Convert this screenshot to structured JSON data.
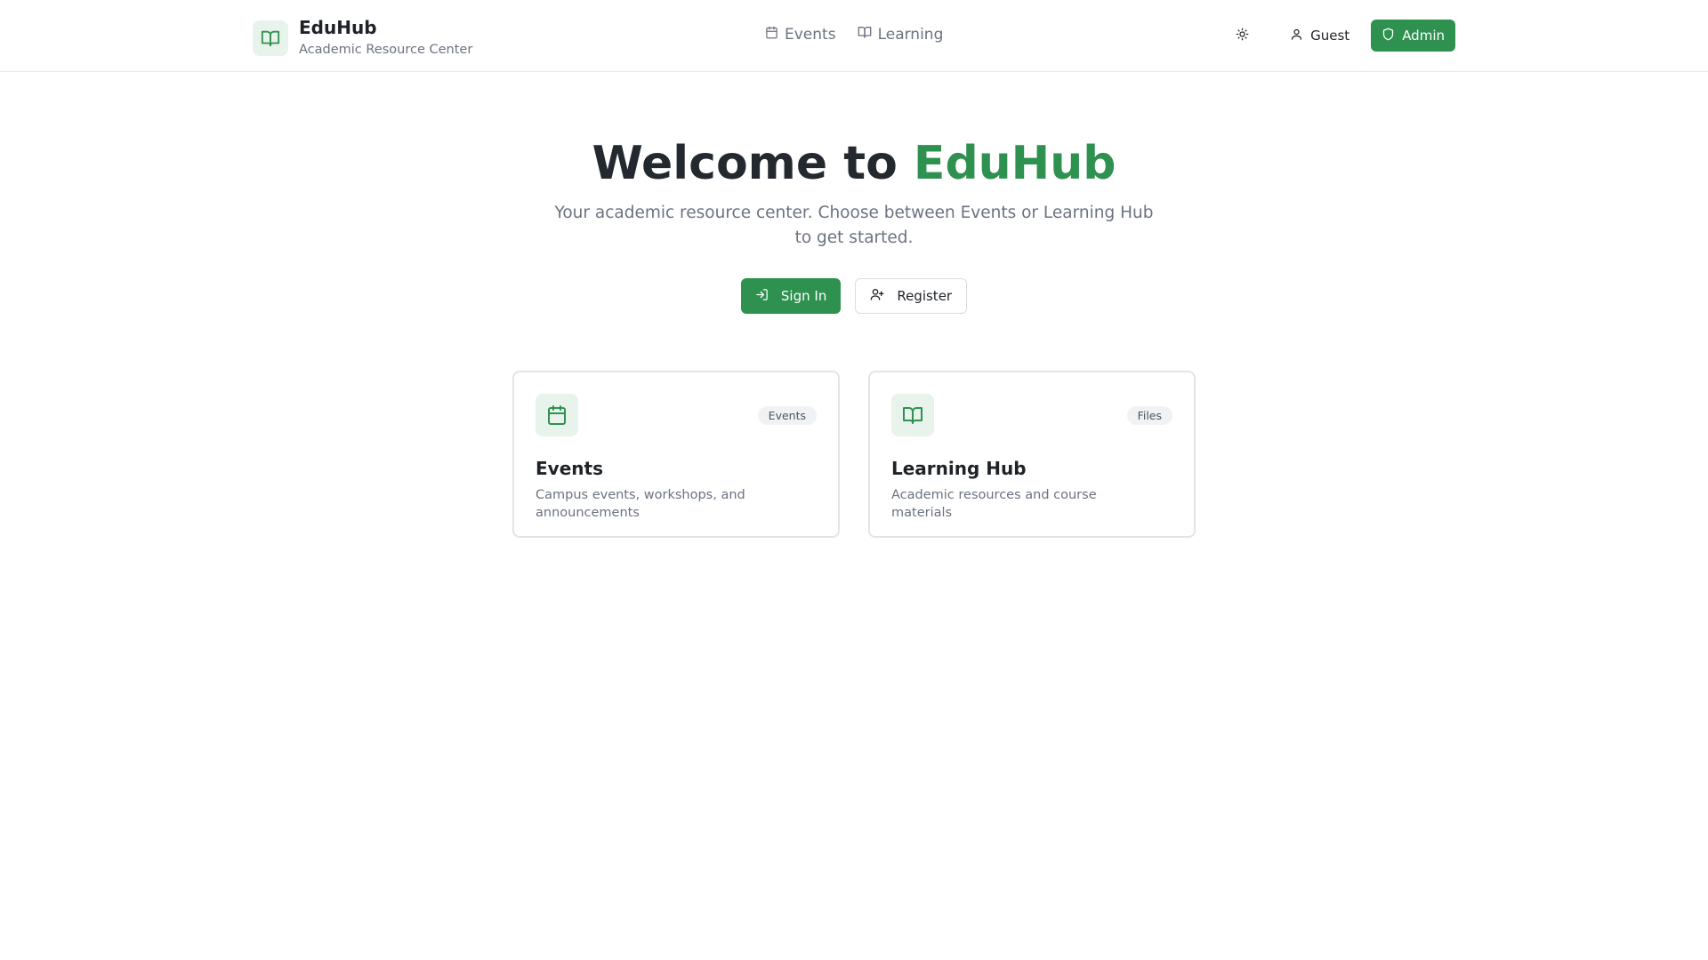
{
  "header": {
    "brand_title": "EduHub",
    "brand_subtitle": "Academic Resource Center",
    "brand_icon": "book-open-icon",
    "nav": [
      {
        "label": "Events",
        "icon": "calendar-icon"
      },
      {
        "label": "Learning",
        "icon": "book-open-icon"
      }
    ],
    "theme_icon": "sun-icon",
    "guest_label": "Guest",
    "admin_label": "Admin"
  },
  "hero": {
    "title_prefix": "Welcome to ",
    "title_accent": "EduHub",
    "subtitle": "Your academic resource center. Choose between Events or Learning Hub to get started.",
    "sign_in_label": "Sign In",
    "register_label": "Register"
  },
  "cards": [
    {
      "title": "Events",
      "badge": "Events",
      "description": "Campus events, workshops, and announcements",
      "icon": "calendar-icon"
    },
    {
      "title": "Learning Hub",
      "badge": "Files",
      "description": "Academic resources and course materials",
      "icon": "book-open-icon"
    }
  ],
  "colors": {
    "accent": "#2e9150",
    "accent_soft": "#e8f3ec",
    "text_muted": "#6b7280",
    "border": "#e1e4e8"
  }
}
